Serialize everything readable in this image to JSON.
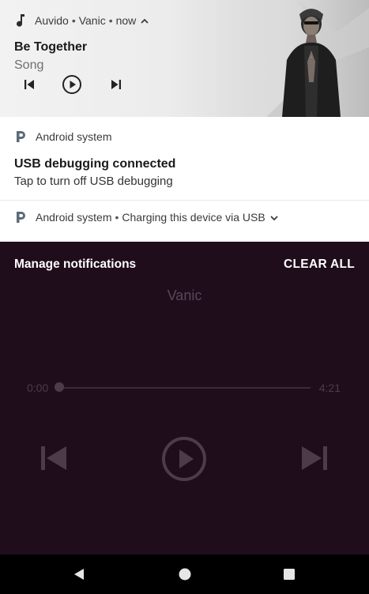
{
  "media_notification": {
    "app_name": "Auvido",
    "artist": "Vanic",
    "time": "now",
    "separator": "•",
    "title": "Be Together",
    "subtitle": "Song",
    "icons": {
      "app": "music-note-icon",
      "expand": "chevron-up-icon",
      "prev": "skip-previous-icon",
      "play": "play-circle-icon",
      "next": "skip-next-icon"
    }
  },
  "usb_notification": {
    "source": "Android system",
    "title": "USB debugging connected",
    "text": "Tap to turn off USB debugging"
  },
  "charging_notification": {
    "source": "Android system",
    "separator": "•",
    "text": "Charging this device via USB"
  },
  "shade_actions": {
    "manage": "Manage notifications",
    "clear_all": "CLEAR ALL"
  },
  "player": {
    "artist": "Vanic",
    "elapsed": "0:00",
    "duration": "4:21",
    "progress": 0.0
  },
  "colors": {
    "shade_bg": "#1f0d1c",
    "notification_bg": "#ffffff",
    "accent_icon": "#5b6b7a"
  }
}
